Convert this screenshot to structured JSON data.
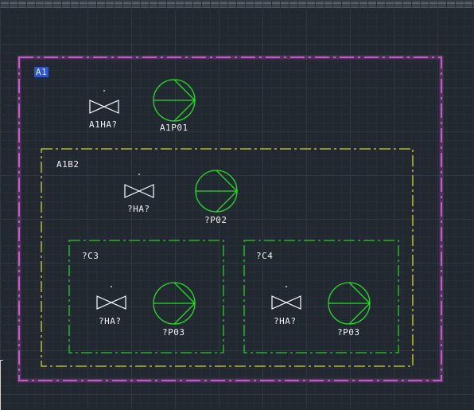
{
  "colors": {
    "background": "#212830",
    "grid_minor": "#262e37",
    "grid_major": "#2f3842",
    "area_border": "#c45ac8",
    "building_border": "#d4d42a",
    "cell_border": "#22d022",
    "pump": "#22e022",
    "valve": "#ffffff",
    "label": "#f2f2f2",
    "selected_label_bg": "#2b55c8"
  },
  "area": {
    "label": "A1"
  },
  "building": {
    "label": "A1B2"
  },
  "cells": [
    {
      "label": "?C3"
    },
    {
      "label": "?C4"
    }
  ],
  "valves": [
    {
      "tag": "A1HA?",
      "icon": "valve-icon"
    },
    {
      "tag": "?HA?",
      "icon": "valve-icon"
    },
    {
      "tag": "?HA?",
      "icon": "valve-icon"
    },
    {
      "tag": "?HA?",
      "icon": "valve-icon"
    }
  ],
  "pumps": [
    {
      "tag": "A1P01",
      "icon": "pump-icon"
    },
    {
      "tag": "?P02",
      "icon": "pump-icon"
    },
    {
      "tag": "?P03",
      "icon": "pump-icon"
    },
    {
      "tag": "?P03",
      "icon": "pump-icon"
    }
  ]
}
